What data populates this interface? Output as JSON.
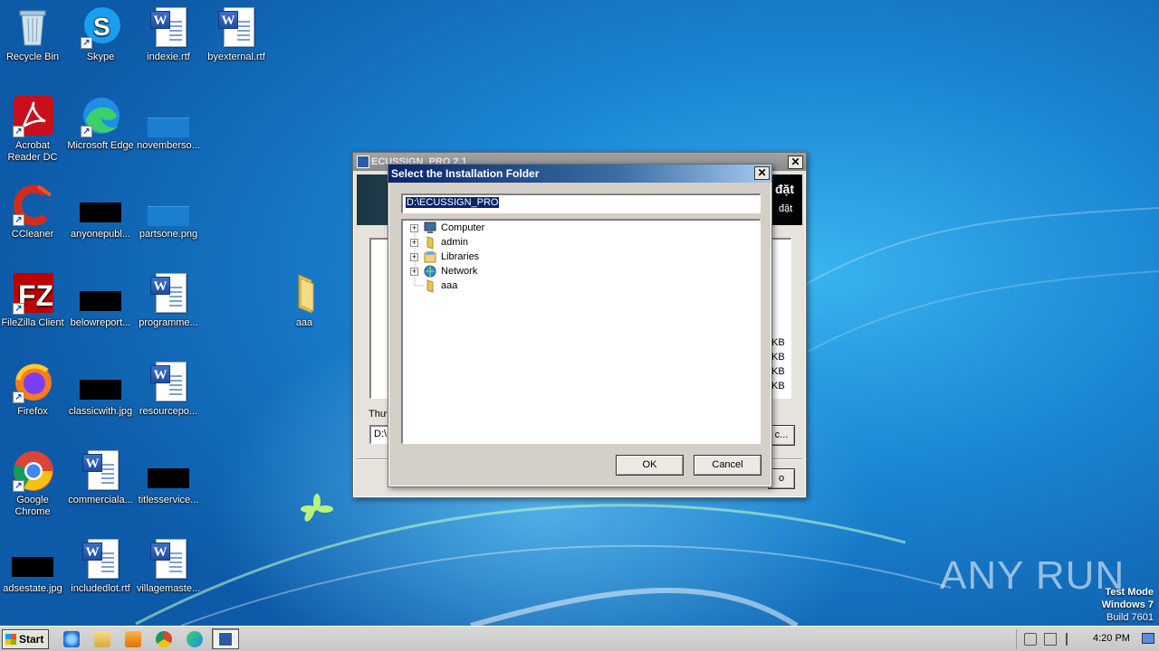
{
  "desktop": {
    "icons": [
      {
        "label": "Recycle Bin"
      },
      {
        "label": "Skype"
      },
      {
        "label": "indexie.rtf"
      },
      {
        "label": "byexternal.rtf"
      },
      {
        "label": "Acrobat Reader DC"
      },
      {
        "label": "Microsoft Edge"
      },
      {
        "label": "novemberso..."
      },
      {
        "label": "CCleaner"
      },
      {
        "label": "anyonepubl..."
      },
      {
        "label": "partsone.png"
      },
      {
        "label": "FileZilla Client"
      },
      {
        "label": "belowreport..."
      },
      {
        "label": "programme..."
      },
      {
        "label": "aaa"
      },
      {
        "label": "Firefox"
      },
      {
        "label": "classicwith.jpg"
      },
      {
        "label": "resourcepo..."
      },
      {
        "label": "Google Chrome"
      },
      {
        "label": "commerciala..."
      },
      {
        "label": "titlesservice..."
      },
      {
        "label": "adsestate.jpg"
      },
      {
        "label": "includedlot.rtf"
      },
      {
        "label": "villagemaste..."
      }
    ],
    "watermark": {
      "brand": "ANY RUN",
      "mode_line1": "Test Mode",
      "mode_line2": "Windows 7",
      "mode_line3": "Build 7601"
    }
  },
  "installer_window": {
    "title": "ECUSSIGN_PRO 2.1",
    "banner_text1": "đặt",
    "banner_text2": "đặt",
    "folder_label": "Thư",
    "path_value": "D:\\",
    "size_lines": [
      "KB",
      "KB",
      "KB",
      "KB"
    ],
    "browse_label": "c...",
    "next_label": "o",
    "close_glyph": "✕"
  },
  "folder_dialog": {
    "title": "Select the Installation Folder",
    "close_glyph": "✕",
    "path_value": "D:\\ECUSSIGN_PRO",
    "tree": [
      {
        "label": "Computer",
        "icon": "computer-icon",
        "expander": "+"
      },
      {
        "label": "admin",
        "icon": "user-folder-icon",
        "expander": "+"
      },
      {
        "label": "Libraries",
        "icon": "libraries-icon",
        "expander": "+"
      },
      {
        "label": "Network",
        "icon": "network-icon",
        "expander": "+"
      },
      {
        "label": "aaa",
        "icon": "folder-icon",
        "expander": ""
      }
    ],
    "ok_label": "OK",
    "cancel_label": "Cancel"
  },
  "taskbar": {
    "start_label": "Start",
    "clock": "4:20 PM",
    "pinned": [
      "internet-explorer-icon",
      "explorer-icon",
      "media-player-icon",
      "chrome-icon",
      "edge-icon",
      "installer-task-icon"
    ]
  },
  "colors": {
    "dialog_title_start": "#0a246a",
    "dialog_title_end": "#a6caf0",
    "selection": "#0a246a"
  }
}
